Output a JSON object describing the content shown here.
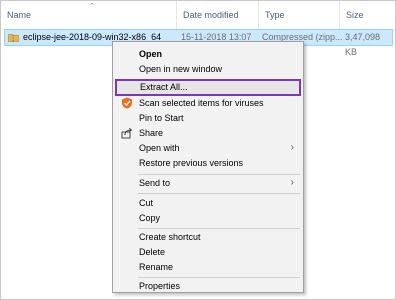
{
  "columns": {
    "name": "Name",
    "date_modified": "Date modified",
    "type": "Type",
    "size": "Size"
  },
  "file": {
    "name": "eclipse-jee-2018-09-win32-x86_64",
    "date_modified": "15-11-2018 13:07",
    "type": "Compressed (zipp...",
    "size": "3,47,098 KB",
    "icon": "zip-folder-icon"
  },
  "menu": {
    "open": "Open",
    "open_new_window": "Open in new window",
    "extract_all": "Extract All...",
    "scan_viruses": "Scan selected items for viruses",
    "pin_to_start": "Pin to Start",
    "share": "Share",
    "open_with": "Open with",
    "restore_versions": "Restore previous versions",
    "send_to": "Send to",
    "cut": "Cut",
    "copy": "Copy",
    "create_shortcut": "Create shortcut",
    "delete": "Delete",
    "rename": "Rename",
    "properties": "Properties"
  },
  "colors": {
    "selection_bg": "#cce8ff",
    "highlight_border": "#7b34c6",
    "menu_bg": "#f2f2f2"
  }
}
